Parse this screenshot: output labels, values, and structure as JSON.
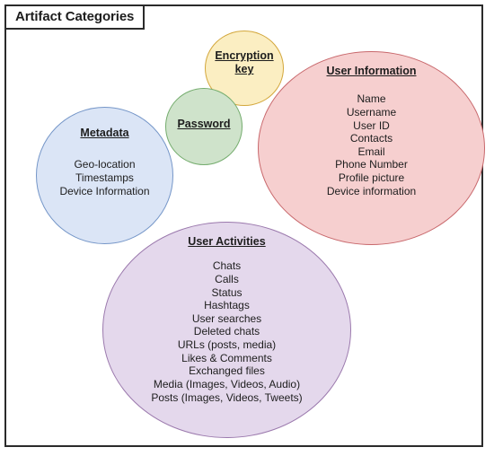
{
  "diagram": {
    "title": "Artifact Categories",
    "bubbles": [
      {
        "id": "metadata",
        "heading": "Metadata",
        "color": "#dbe5f6",
        "border_color": "#7596c8",
        "items": [
          "Geo-location",
          "Timestamps",
          "Device Information"
        ]
      },
      {
        "id": "encryption-key",
        "heading": "Encryption key",
        "heading_line1": "Encryption",
        "heading_line2": "key",
        "color": "#fbeec2",
        "border_color": "#d3a73c",
        "items": []
      },
      {
        "id": "password",
        "heading": "Password",
        "color": "#cfe3cb",
        "border_color": "#74ac6d",
        "items": []
      },
      {
        "id": "user-information",
        "heading": "User Information",
        "color": "#f6cfcf",
        "border_color": "#c8686c",
        "items": [
          "Name",
          "Username",
          "User ID",
          "Contacts",
          "Email",
          "Phone Number",
          "Profile picture",
          "Device information"
        ]
      },
      {
        "id": "user-activities",
        "heading": "User Activities",
        "color": "#e4d8ec",
        "border_color": "#9b79ad",
        "items": [
          "Chats",
          "Calls",
          "Status",
          "Hashtags",
          "User searches",
          "Deleted chats",
          "URLs (posts, media)",
          "Likes & Comments",
          "Exchanged files",
          "Media (Images, Videos, Audio)",
          "Posts (Images, Videos, Tweets)"
        ]
      }
    ]
  }
}
